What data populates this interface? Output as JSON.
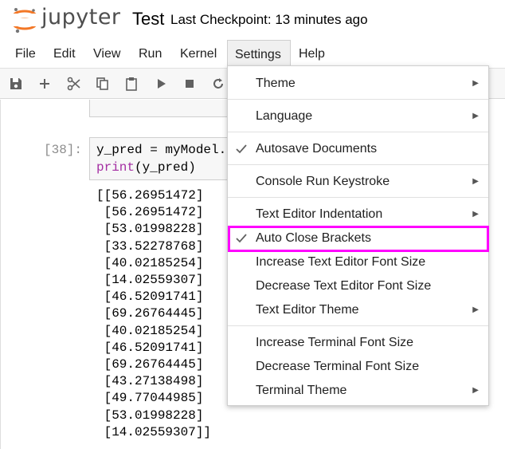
{
  "header": {
    "brand": "jupyter",
    "notebook_title": "Test",
    "checkpoint": "Last Checkpoint: 13 minutes ago",
    "logo_color": "#f37726"
  },
  "menubar": {
    "items": [
      {
        "label": "File"
      },
      {
        "label": "Edit"
      },
      {
        "label": "View"
      },
      {
        "label": "Run"
      },
      {
        "label": "Kernel"
      },
      {
        "label": "Settings"
      },
      {
        "label": "Help"
      }
    ]
  },
  "toolbar": {
    "buttons": [
      "save-icon",
      "add-icon",
      "cut-icon",
      "copy-icon",
      "paste-icon",
      "run-icon",
      "stop-icon",
      "restart-icon"
    ]
  },
  "cell": {
    "prompt": "[38]:",
    "code_line1": "y_pred = myModel.",
    "code_line2_kw": "print",
    "code_line2_rest": "(y_pred)",
    "output": "[[56.26951472]\n [56.26951472]\n [53.01998228]\n [33.52278768]\n [40.02185254]\n [14.02559307]\n [46.52091741]\n [69.26764445]\n [40.02185254]\n [46.52091741]\n [69.26764445]\n [43.27138498]\n [49.77044985]\n [53.01998228]\n [14.02559307]]"
  },
  "settings_menu": {
    "theme": "Theme",
    "language": "Language",
    "autosave": "Autosave Documents",
    "console_run": "Console Run Keystroke",
    "indentation": "Text Editor Indentation",
    "auto_close": "Auto Close Brackets",
    "inc_editor_font": "Increase Text Editor Font Size",
    "dec_editor_font": "Decrease Text Editor Font Size",
    "editor_theme": "Text Editor Theme",
    "inc_terminal_font": "Increase Terminal Font Size",
    "dec_terminal_font": "Decrease Terminal Font Size",
    "terminal_theme": "Terminal Theme",
    "highlight_color": "#ff00ff"
  }
}
